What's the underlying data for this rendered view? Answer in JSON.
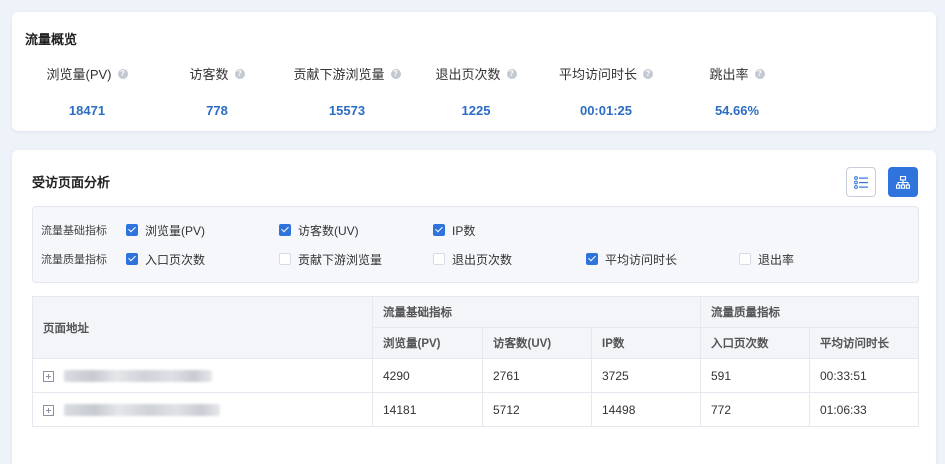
{
  "overview": {
    "title": "流量概览",
    "metrics": [
      {
        "label": "浏览量(PV)",
        "value": "18471"
      },
      {
        "label": "访客数",
        "value": "778"
      },
      {
        "label": "贡献下游浏览量",
        "value": "15573"
      },
      {
        "label": "退出页次数",
        "value": "1225"
      },
      {
        "label": "平均访问时长",
        "value": "00:01:25"
      },
      {
        "label": "跳出率",
        "value": "54.66%"
      }
    ]
  },
  "analysis": {
    "title": "受访页面分析",
    "filters": {
      "basic": {
        "label": "流量基础指标",
        "options": [
          {
            "label": "浏览量(PV)",
            "checked": true
          },
          {
            "label": "访客数(UV)",
            "checked": true
          },
          {
            "label": "IP数",
            "checked": true
          }
        ]
      },
      "quality": {
        "label": "流量质量指标",
        "options": [
          {
            "label": "入口页次数",
            "checked": true
          },
          {
            "label": "贡献下游浏览量",
            "checked": false
          },
          {
            "label": "退出页次数",
            "checked": false
          },
          {
            "label": "平均访问时长",
            "checked": true
          },
          {
            "label": "退出率",
            "checked": false
          }
        ]
      }
    },
    "table": {
      "page_col": "页面地址",
      "group_basic": "流量基础指标",
      "group_quality": "流量质量指标",
      "columns": [
        "浏览量(PV)",
        "访客数(UV)",
        "IP数",
        "入口页次数",
        "平均访问时长"
      ],
      "rows": [
        {
          "pv": "4290",
          "uv": "2761",
          "ip": "3725",
          "entry": "591",
          "avg": "00:33:51"
        },
        {
          "pv": "14181",
          "uv": "5712",
          "ip": "14498",
          "entry": "772",
          "avg": "01:06:33"
        }
      ]
    }
  },
  "colors": {
    "accent": "#2f74dc",
    "value": "#2b6dc4"
  },
  "icons": [
    "help-icon",
    "list-view-icon",
    "tree-view-icon",
    "expand-plus-icon",
    "checkbox-icon"
  ]
}
